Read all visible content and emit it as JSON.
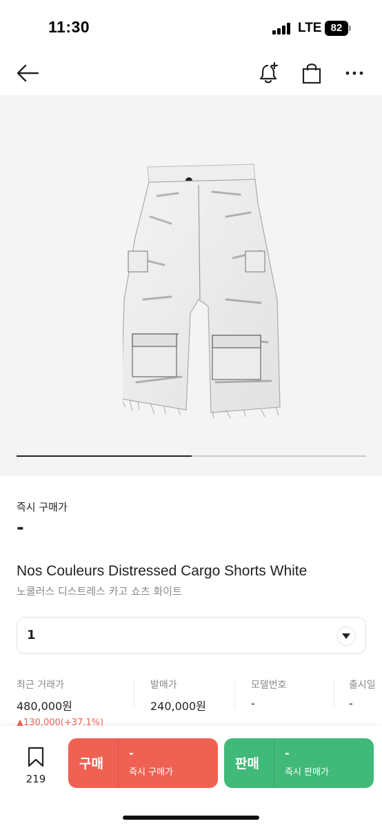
{
  "status_bar": {
    "time": "11:30",
    "network": "LTE",
    "battery": "82"
  },
  "nav": {
    "icons": [
      "back-arrow-icon",
      "bell-plus-icon",
      "shopping-bag-icon",
      "more-icon"
    ]
  },
  "gallery": {
    "progress": 0.5
  },
  "product": {
    "instant_buy_label": "즉시 구매가",
    "instant_buy_price": "-",
    "name_en": "Nos Couleurs Distressed Cargo Shorts White",
    "name_ko": "노쿨러스 디스트레스 카고 쇼츠 화이트"
  },
  "size_select": {
    "value": "1"
  },
  "stats": [
    {
      "label": "최근 거래가",
      "value": "480,000원",
      "change": "▲130,000(+37.1%)"
    },
    {
      "label": "발매가",
      "value": "240,000원"
    },
    {
      "label": "모델번호",
      "value": "-"
    },
    {
      "label": "출시일",
      "value": "-"
    }
  ],
  "bottom": {
    "wish_count": "219",
    "buy": {
      "label": "구매",
      "price": "-",
      "sub": "즉시 구매가"
    },
    "sell": {
      "label": "판매",
      "price": "-",
      "sub": "즉시 판매가"
    }
  },
  "colors": {
    "buy": "#ef6253",
    "sell": "#41b979",
    "up": "#ef6253"
  }
}
